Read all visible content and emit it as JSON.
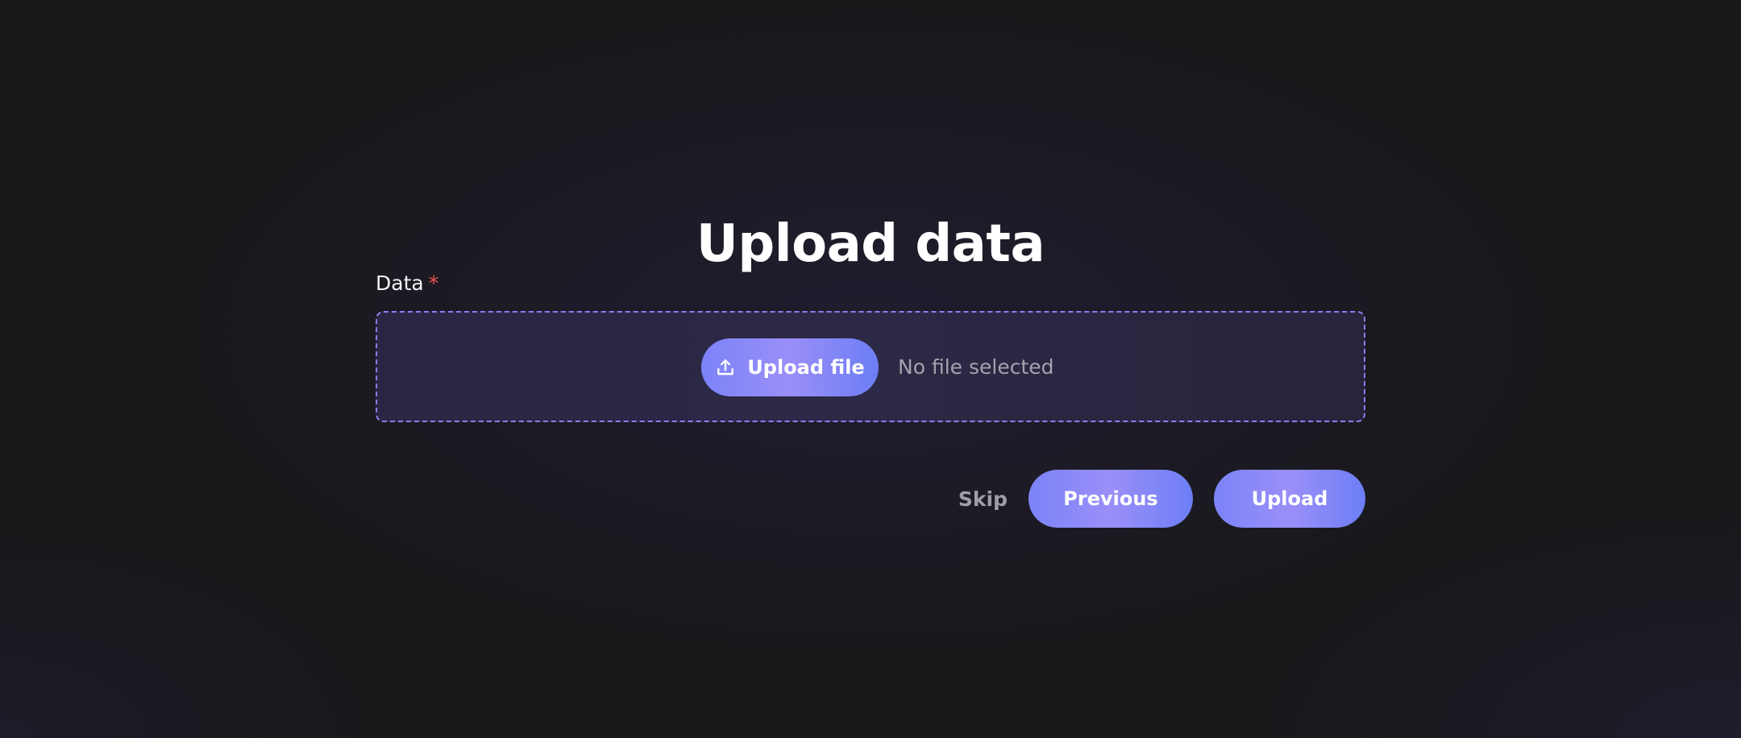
{
  "page": {
    "title": "Upload data"
  },
  "field": {
    "label": "Data",
    "required_marker": "*"
  },
  "dropzone": {
    "upload_button_label": "Upload file",
    "upload_icon": "upload-icon",
    "status_text": "No file selected"
  },
  "actions": {
    "skip_label": "Skip",
    "previous_label": "Previous",
    "upload_label": "Upload"
  },
  "colors": {
    "background": "#18181a",
    "accent_start": "#7b83f7",
    "accent_mid": "#9a8ff8",
    "accent_end": "#6c7ef5",
    "dropzone_border": "#8f7cf0",
    "required": "#ef5350"
  }
}
